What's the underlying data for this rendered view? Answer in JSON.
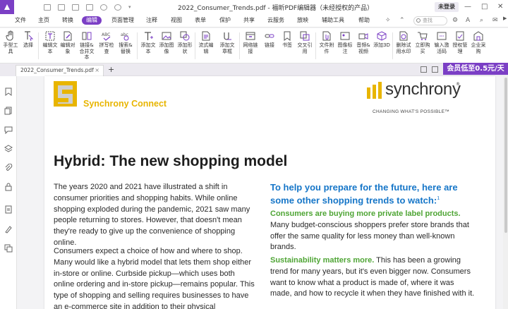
{
  "window": {
    "title": "2022_Consumer_Trends.pdf - 福昕PDF编辑器（未经授权的产品）",
    "login_label": "未登录",
    "minimize": "—",
    "maximize": "□",
    "close": "✕"
  },
  "menu": {
    "items": [
      "文件",
      "主页",
      "转换",
      "编辑",
      "页面管理",
      "注释",
      "视图",
      "表单",
      "保护",
      "共享",
      "云服务",
      "放映",
      "辅助工具",
      "帮助"
    ],
    "active": "编辑",
    "search_placeholder": "查找"
  },
  "toolbar": {
    "tools": [
      {
        "label": "手型工具",
        "icon": "hand-icon"
      },
      {
        "label": "选择",
        "icon": "select-icon"
      },
      {
        "label": "编辑文本",
        "icon": "edit-text-icon"
      },
      {
        "label": "编辑对象",
        "icon": "edit-object-icon"
      },
      {
        "label": "链接&合并文本",
        "icon": "link-merge-icon"
      },
      {
        "label": "拼写检查",
        "icon": "spellcheck-icon"
      },
      {
        "label": "搜索&替换",
        "icon": "search-replace-icon"
      },
      {
        "label": "添加文本",
        "icon": "add-text-icon"
      },
      {
        "label": "添加图像",
        "icon": "add-image-icon"
      },
      {
        "label": "添加形状",
        "icon": "add-shape-icon"
      },
      {
        "label": "流式编辑",
        "icon": "flow-edit-icon"
      },
      {
        "label": "添加文章框",
        "icon": "article-box-icon"
      },
      {
        "label": "网络链接",
        "icon": "web-link-icon"
      },
      {
        "label": "链接",
        "icon": "link-icon"
      },
      {
        "label": "书签",
        "icon": "bookmark-icon"
      },
      {
        "label": "交叉引用",
        "icon": "cross-reference-icon"
      },
      {
        "label": "文件附件",
        "icon": "file-attachment-icon"
      },
      {
        "label": "图像标注",
        "icon": "image-annotation-icon"
      },
      {
        "label": "音频&视频",
        "icon": "audio-video-icon"
      },
      {
        "label": "添加3D",
        "icon": "add-3d-icon"
      },
      {
        "label": "删除试用水印",
        "icon": "remove-watermark-icon"
      },
      {
        "label": "立即购买",
        "icon": "buy-now-icon"
      },
      {
        "label": "输入激活码",
        "icon": "activation-code-icon"
      },
      {
        "label": "授权管理",
        "icon": "license-icon"
      },
      {
        "label": "企业采购",
        "icon": "enterprise-icon"
      }
    ]
  },
  "tabs": {
    "file_tab": "2022_Consumer_Trends.pdf",
    "close": "×",
    "new_tab": "+"
  },
  "promo": "会员低至0.5元/天",
  "document": {
    "brand_left": "Synchrony Connect",
    "brand_right": "synchrony",
    "brand_reg": "®",
    "tagline": "CHANGING WHAT'S POSSIBLE™",
    "heading": "Hybrid: The new shopping model",
    "left_para_1": "The years 2020 and 2021 have illustrated a shift in consumer priorities and shopping habits. While online shopping exploded during the pandemic, 2021 saw many people returning to stores. However, that doesn't mean they're ready to give up the convenience of shopping online.",
    "left_para_2": "Consumers expect a choice of how and where to shop. Many would like a hybrid model that lets them shop either in-store or online. Curbside pickup—which uses both online ordering and in-store pickup—remains popular. This type of shopping and selling requires businesses to have an e-commerce site in addition to their physical",
    "right_heading": "To help you prepare for the future, here are some other shopping trends to watch:",
    "right_heading_sup": "1",
    "trend_1_title": "Consumers are buying more private label products.",
    "trend_1_text": "Many budget-conscious shoppers prefer store brands that offer the same quality for less money than well-known brands.",
    "trend_2_title": "Sustainability matters more.",
    "trend_2_text": " This has been a growing trend for many years, but it's even bigger now. Consumers want to know what a product is made of, where it was made, and how to recycle it when they have finished with it."
  },
  "colors": {
    "accent": "#7b3fc5",
    "synchrony_yellow": "#e8b500",
    "heading_blue": "#1676c8",
    "trend_green": "#4fa535"
  }
}
